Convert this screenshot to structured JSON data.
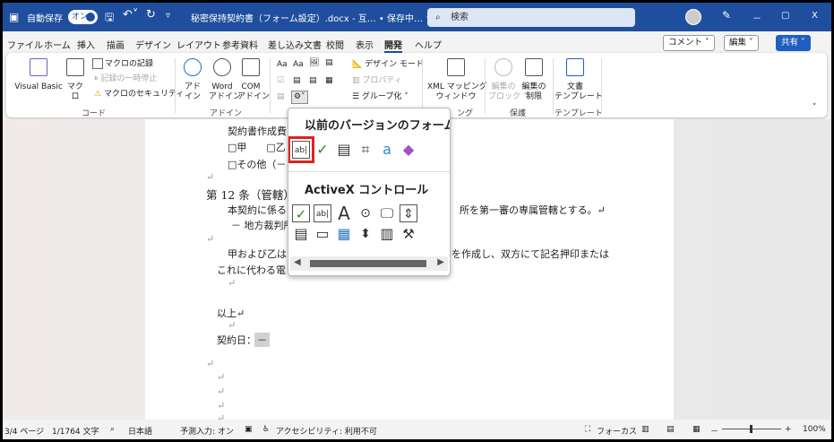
{
  "titlebar": {
    "autosave_label": "自動保存",
    "autosave_state": "オン",
    "doc_title": "秘密保持契約書（フォーム設定）.docx - 互…  • 保存中… ∨",
    "search_placeholder": "検索",
    "minimize": "－",
    "restore": "▢",
    "close": "X",
    "qat_more": "▿"
  },
  "menu": {
    "tabs": [
      "ファイル",
      "ホーム",
      "挿入",
      "描画",
      "デザイン",
      "レイアウト",
      "参考資料",
      "差し込み文書",
      "校閲",
      "表示",
      "開発",
      "ヘルプ"
    ],
    "active_tab": "開発",
    "comment": "コメント ˅",
    "edit": "編集 ˅",
    "share": "共有 ˅"
  },
  "ribbon": {
    "code": {
      "visual_basic": "Visual Basic",
      "macro": "マクロ",
      "record": "マクロの記録",
      "pause": "記録の一時停止",
      "security": "マクロのセキュリティ",
      "group": "コード"
    },
    "addin": {
      "addin": "アド\nイン",
      "word_addin": "Word\nアドイン",
      "com_addin": "COM\nアドイン",
      "group": "アドイン"
    },
    "controls": {
      "design_mode": "デザイン モード",
      "properties": "プロパティ",
      "group_btn": "グループ化 ˅",
      "aa1": "Aa",
      "aa2": "Aa"
    },
    "mapping": {
      "xml": "XML マッピング\nウィンドウ",
      "group": "ング"
    },
    "protect": {
      "block": "編集の\nブロック ˅",
      "restrict": "編集の\n制限",
      "group": "保護"
    },
    "template": {
      "doc_template": "文書\nテンプレート",
      "group": "テンプレート"
    }
  },
  "popup": {
    "legacy_title": "以前のバージョンのフォーム",
    "activex_title": "ActiveX コントロール",
    "text_field": "ab|"
  },
  "document": {
    "lines": [
      "契約書作成費",
      "□甲　　□乙",
      "□その他（－",
      "↵",
      "第 12 条（管轄）",
      "本契約に係る",
      "所を第一審の専属管轄とする。↵",
      "－ 地方裁判所",
      "↵",
      "甲および乙は",
      "書を作成し、双方にて記名押印または",
      "これに代わる電",
      "↵",
      "以上↵",
      "↵",
      "契約日：",
      "－",
      "↵",
      "↵",
      "↵",
      "↵",
      "↵",
      "↵"
    ]
  },
  "statusbar": {
    "page": "3/4 ページ",
    "words": "1/1764 文字",
    "language": "日本語",
    "predict": "予測入力: オン",
    "accessibility": "アクセシビリティ: 利用不可",
    "focus": "フォーカス",
    "zoom": "100%",
    "zoom_minus": "－",
    "zoom_plus": "+",
    "zoom_level_percent": 100
  },
  "colors": {
    "titlebar": "#1f4e9e",
    "highlight": "#e02020"
  }
}
